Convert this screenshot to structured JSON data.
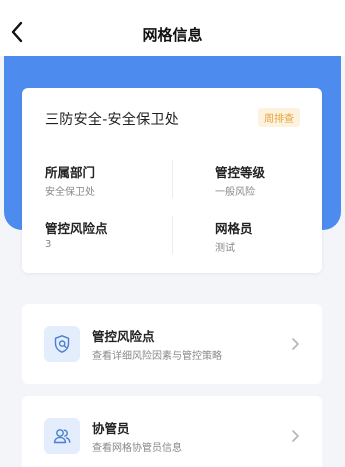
{
  "header": {
    "title": "网格信息",
    "back_icon": "chevron-left-icon"
  },
  "grid_card": {
    "name": "三防安全-安全保卫处",
    "badge": "周排查",
    "badge_color": "#e5a33a",
    "fields": [
      {
        "label": "所属部门",
        "value": "安全保卫处"
      },
      {
        "label": "管控等级",
        "value": "一般风险"
      },
      {
        "label": "管控风险点",
        "value": "3"
      },
      {
        "label": "网格员",
        "value": "测试"
      }
    ]
  },
  "entries": [
    {
      "title": "管控风险点",
      "subtitle": "查看详细风险因素与管控策略",
      "icon": "shield-search-icon"
    },
    {
      "title": "协管员",
      "subtitle": "查看网格协管员信息",
      "icon": "users-icon"
    }
  ],
  "colors": {
    "accent": "#4d8cee",
    "icon_bg": "#e3edfc",
    "icon_stroke": "#4a7fd1",
    "background": "#f3f5f9"
  }
}
